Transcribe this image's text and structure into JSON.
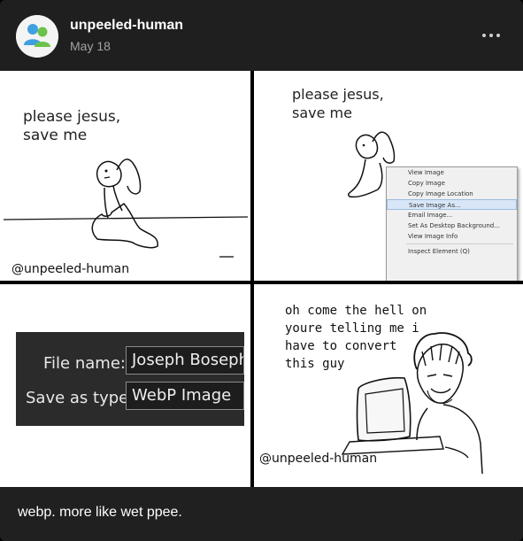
{
  "post": {
    "username": "unpeeled-human",
    "date": "May 18",
    "caption": "webp. more like wet ppee."
  },
  "icons": {
    "avatar": "msn-messenger-avatar-icon",
    "more": "more-options-icon"
  },
  "comic": {
    "panel1": {
      "text": "please jesus,\nsave me",
      "watermark": "@unpeeled-human"
    },
    "panel2": {
      "text": "please jesus,\nsave me",
      "context_menu": [
        "View Image",
        "Copy Image",
        "Copy Image Location",
        "Save Image As...",
        "Email Image...",
        "Set As Desktop Background...",
        "View Image Info",
        "Inspect Element (Q)"
      ],
      "highlighted_item": "Save Image As..."
    },
    "panel3": {
      "file_name_label": "File name:",
      "file_name_value": "Joseph Boseph",
      "save_type_label": "Save as type:",
      "save_type_value": "WebP Image"
    },
    "panel4": {
      "text": "oh come the hell on\nyoure telling me i\nhave to convert\nthis guy",
      "watermark": "@unpeeled-human"
    }
  },
  "colors": {
    "background": "#202020",
    "username": "#ffffff",
    "date": "#a3a3a3",
    "dialog_bg": "#2b2b2b"
  }
}
